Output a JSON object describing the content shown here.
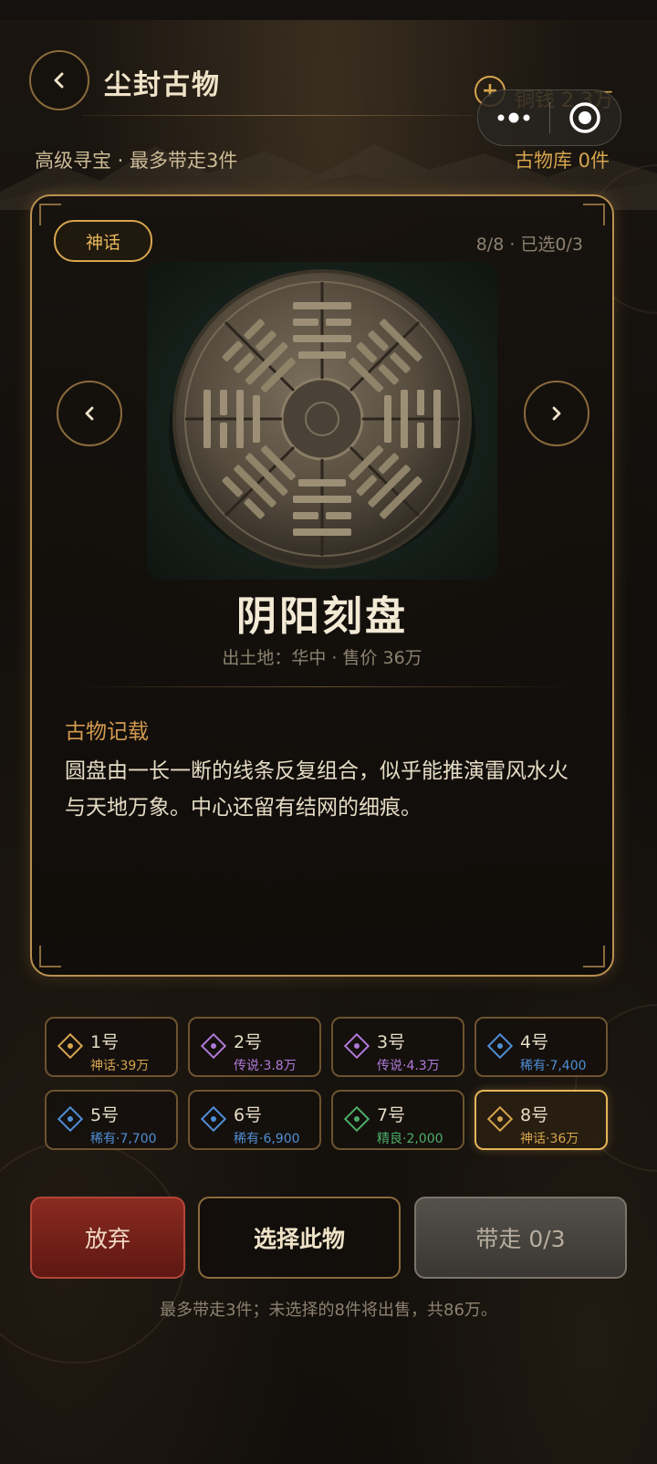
{
  "header": {
    "title": "尘封古物",
    "coins_label": "铜钱 2.3万",
    "subtitle": "高级寻宝 · 最多带走3件",
    "inventory": "古物库 0件"
  },
  "card": {
    "rarity": "神话",
    "counter": "8/8 · 已选0/3",
    "name": "阴阳刻盘",
    "meta": "出土地：华中 · 售价 36万",
    "record_title": "古物记载",
    "record_text": "圆盘由一长一断的线条反复组合，似乎能推演雷风水火与天地万象。中心还留有结网的细痕。"
  },
  "slots": [
    {
      "num": "1号",
      "info": "神话·39万",
      "color": "#d7a54e"
    },
    {
      "num": "2号",
      "info": "传说·3.8万",
      "color": "#b07ad9"
    },
    {
      "num": "3号",
      "info": "传说·4.3万",
      "color": "#b07ad9"
    },
    {
      "num": "4号",
      "info": "稀有·7,400",
      "color": "#4f8fd6"
    },
    {
      "num": "5号",
      "info": "稀有·7,700",
      "color": "#4f8fd6"
    },
    {
      "num": "6号",
      "info": "稀有·6,900",
      "color": "#4f8fd6"
    },
    {
      "num": "7号",
      "info": "精良·2,000",
      "color": "#4dae6a"
    },
    {
      "num": "8号",
      "info": "神话·36万",
      "color": "#d7a54e"
    }
  ],
  "selected_slot": 8,
  "actions": {
    "abandon": "放弃",
    "select": "选择此物",
    "take": "带走 0/3"
  },
  "footer_note": "最多带走3件；未选择的8件将出售，共86万。",
  "colors": {
    "gold": "#d7a54e",
    "mythic": "#d7a54e",
    "legendary": "#b07ad9",
    "rare": "#4f8fd6",
    "fine": "#4dae6a",
    "danger": "#8a2a20"
  },
  "icons": {
    "back": "chevron-left-icon",
    "add": "plus-icon",
    "more": "more-dots-icon",
    "close": "target-icon",
    "prev": "chevron-left-icon",
    "next": "chevron-right-icon",
    "slot": "diamond-icon"
  }
}
